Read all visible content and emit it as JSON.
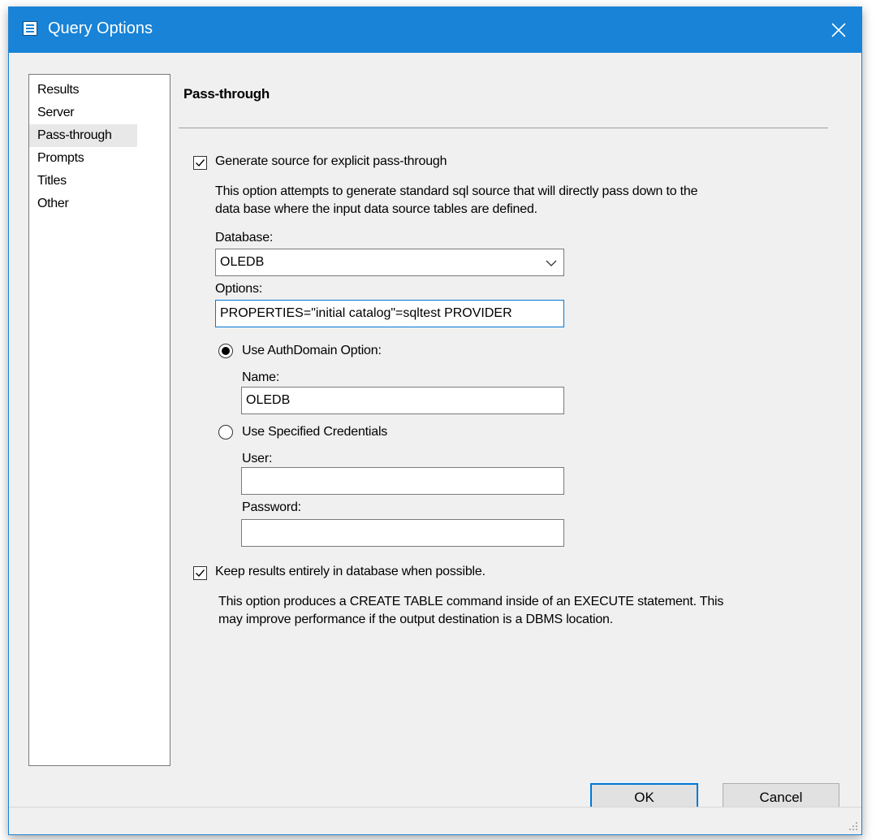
{
  "window": {
    "title": "Query Options",
    "close_icon": "close-icon",
    "accent": "#1883d7"
  },
  "nav": {
    "items": [
      {
        "label": "Results"
      },
      {
        "label": "Server"
      },
      {
        "label": "Pass-through",
        "selected": true
      },
      {
        "label": "Prompts"
      },
      {
        "label": "Titles"
      },
      {
        "label": "Other"
      }
    ]
  },
  "panel": {
    "title": "Pass-through",
    "generate_source": {
      "checked": true,
      "label": "Generate source for explicit pass-through",
      "description_line1": "This option attempts to generate standard sql source that will directly pass down to the",
      "description_line2": "data base where the input data source tables are defined."
    },
    "database": {
      "label": "Database:",
      "value": "OLEDB"
    },
    "options": {
      "label": "Options:",
      "value": "PROPERTIES=\"initial catalog\"=sqltest PROVIDER"
    },
    "authdomain": {
      "selected": true,
      "label": "Use AuthDomain Option:",
      "name_label": "Name:",
      "name_value": "OLEDB"
    },
    "credentials": {
      "selected": false,
      "label": "Use Specified Credentials",
      "user_label": "User:",
      "user_value": "",
      "password_label": "Password:",
      "password_value": ""
    },
    "keep_results": {
      "checked": true,
      "label": "Keep results entirely in database when possible.",
      "description_line1": "This option produces a CREATE TABLE command inside of an EXECUTE statement.  This",
      "description_line2": "may improve performance if the output destination is a DBMS location."
    }
  },
  "buttons": {
    "ok": "OK",
    "cancel": "Cancel"
  }
}
